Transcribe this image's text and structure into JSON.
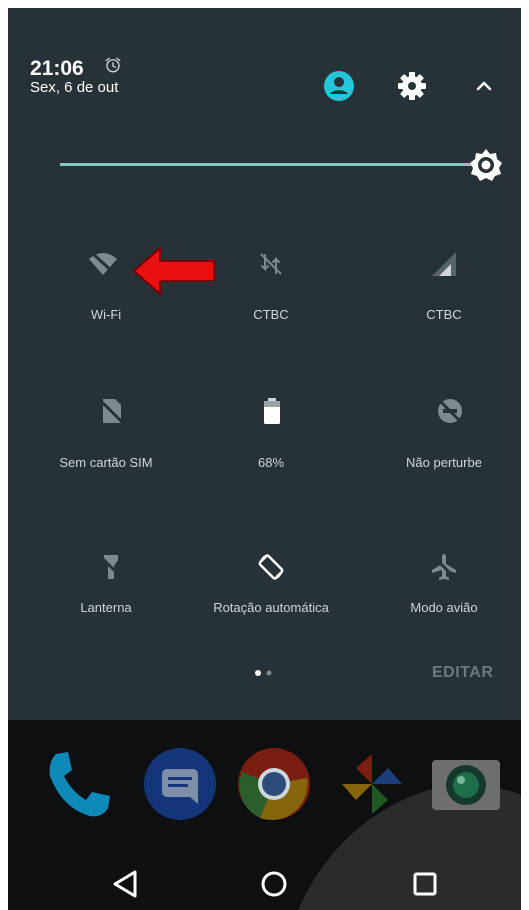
{
  "status": {
    "time": "21:06",
    "date": "Sex, 6 de out",
    "alarm_icon": "alarm-clock-icon"
  },
  "header_icons": [
    "account-icon",
    "settings-gear-icon",
    "collapse-chevron-up-icon"
  ],
  "colors": {
    "panel_background": "#263238",
    "accent": "#80cbc4",
    "account_icon": "#26c6da",
    "tile_icon_dim": "#7d8a90",
    "tile_icon_bright": "#ffffff",
    "annotation_arrow": "#e81010"
  },
  "brightness": {
    "level_percent": 100,
    "icon": "brightness-icon"
  },
  "tiles": [
    {
      "label": "Wi-Fi",
      "icon": "wifi-off-icon"
    },
    {
      "label": "CTBC",
      "icon": "mobile-data-off-icon"
    },
    {
      "label": "CTBC",
      "icon": "cell-signal-icon"
    },
    {
      "label": "Sem cartão SIM",
      "icon": "no-sim-icon"
    },
    {
      "label": "68%",
      "icon": "battery-icon"
    },
    {
      "label": "Não perturbe",
      "icon": "do-not-disturb-off-icon"
    },
    {
      "label": "Lanterna",
      "icon": "flashlight-off-icon"
    },
    {
      "label": "Rotação automática",
      "icon": "screen-rotation-icon"
    },
    {
      "label": "Modo avião",
      "icon": "airplane-mode-off-icon"
    }
  ],
  "page_indicator": {
    "current": 1,
    "total": 2
  },
  "edit_label": "EDITAR",
  "annotation": {
    "type": "red-arrow",
    "points_to": "Wi-Fi"
  },
  "dock_apps": [
    "phone-app-icon",
    "messages-app-icon",
    "chrome-app-icon",
    "photos-app-icon",
    "camera-app-icon"
  ],
  "nav_buttons": [
    "back-icon",
    "home-icon",
    "recents-icon"
  ]
}
